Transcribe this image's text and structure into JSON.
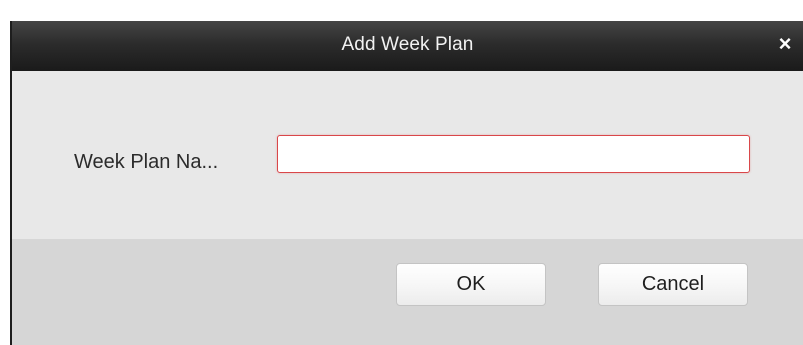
{
  "dialog": {
    "title": "Add Week Plan",
    "close_icon": "close-icon",
    "close_glyph": "×"
  },
  "form": {
    "label": "Week Plan Na...",
    "input_value": "",
    "input_state": "invalid",
    "input_border_color": "#d9474a"
  },
  "buttons": {
    "ok_label": "OK",
    "cancel_label": "Cancel"
  },
  "colors": {
    "title_bar": "#2c2c2c",
    "dialog_body": "#e8e8e8",
    "footer": "#d6d6d6"
  }
}
